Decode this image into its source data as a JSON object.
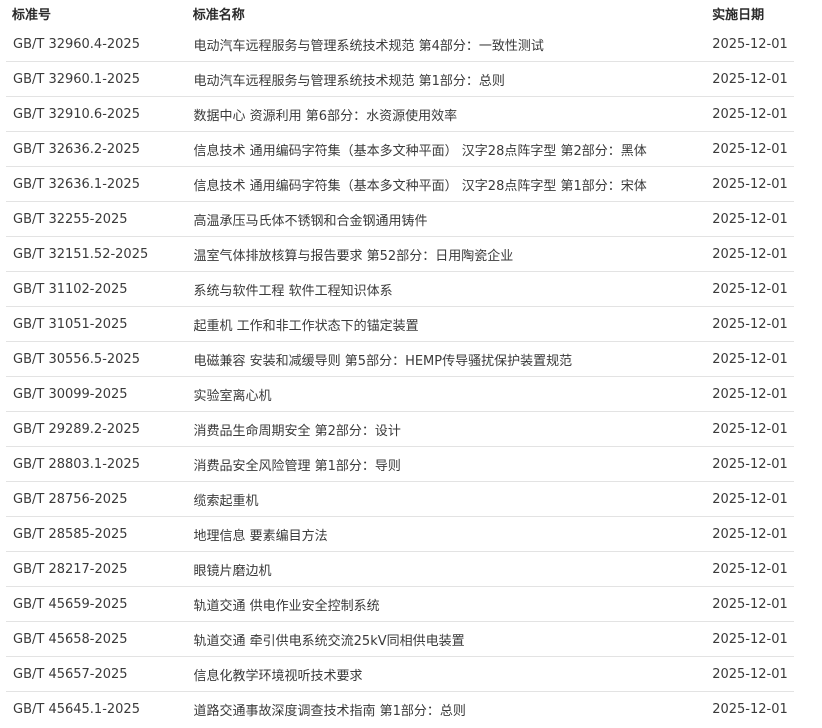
{
  "table": {
    "headers": {
      "code": "标准号",
      "name": "标准名称",
      "date": "实施日期"
    },
    "rows": [
      {
        "code": "GB/T 32960.4-2025",
        "name": "电动汽车远程服务与管理系统技术规范 第4部分：一致性测试",
        "date": "2025-12-01"
      },
      {
        "code": "GB/T 32960.1-2025",
        "name": "电动汽车远程服务与管理系统技术规范 第1部分：总则",
        "date": "2025-12-01"
      },
      {
        "code": "GB/T 32910.6-2025",
        "name": "数据中心 资源利用 第6部分：水资源使用效率",
        "date": "2025-12-01"
      },
      {
        "code": "GB/T 32636.2-2025",
        "name": "信息技术 通用编码字符集（基本多文种平面） 汉字28点阵字型 第2部分：黑体",
        "date": "2025-12-01"
      },
      {
        "code": "GB/T 32636.1-2025",
        "name": "信息技术 通用编码字符集（基本多文种平面） 汉字28点阵字型 第1部分：宋体",
        "date": "2025-12-01"
      },
      {
        "code": "GB/T 32255-2025",
        "name": "高温承压马氏体不锈钢和合金钢通用铸件",
        "date": "2025-12-01"
      },
      {
        "code": "GB/T 32151.52-2025",
        "name": "温室气体排放核算与报告要求 第52部分：日用陶瓷企业",
        "date": "2025-12-01"
      },
      {
        "code": "GB/T 31102-2025",
        "name": "系统与软件工程 软件工程知识体系",
        "date": "2025-12-01"
      },
      {
        "code": "GB/T 31051-2025",
        "name": "起重机 工作和非工作状态下的锚定装置",
        "date": "2025-12-01"
      },
      {
        "code": "GB/T 30556.5-2025",
        "name": "电磁兼容 安装和减缓导则 第5部分：HEMP传导骚扰保护装置规范",
        "date": "2025-12-01"
      },
      {
        "code": "GB/T 30099-2025",
        "name": "实验室离心机",
        "date": "2025-12-01"
      },
      {
        "code": "GB/T 29289.2-2025",
        "name": "消费品生命周期安全 第2部分：设计",
        "date": "2025-12-01"
      },
      {
        "code": "GB/T 28803.1-2025",
        "name": "消费品安全风险管理 第1部分：导则",
        "date": "2025-12-01"
      },
      {
        "code": "GB/T 28756-2025",
        "name": "缆索起重机",
        "date": "2025-12-01"
      },
      {
        "code": "GB/T 28585-2025",
        "name": "地理信息 要素编目方法",
        "date": "2025-12-01"
      },
      {
        "code": "GB/T 28217-2025",
        "name": "眼镜片磨边机",
        "date": "2025-12-01"
      },
      {
        "code": "GB/T 45659-2025",
        "name": "轨道交通 供电作业安全控制系统",
        "date": "2025-12-01"
      },
      {
        "code": "GB/T 45658-2025",
        "name": "轨道交通 牵引供电系统交流25kV同相供电装置",
        "date": "2025-12-01"
      },
      {
        "code": "GB/T 45657-2025",
        "name": "信息化教学环境视听技术要求",
        "date": "2025-12-01"
      },
      {
        "code": "GB/T 45645.1-2025",
        "name": "道路交通事故深度调查技术指南 第1部分：总则",
        "date": "2025-12-01"
      }
    ]
  }
}
